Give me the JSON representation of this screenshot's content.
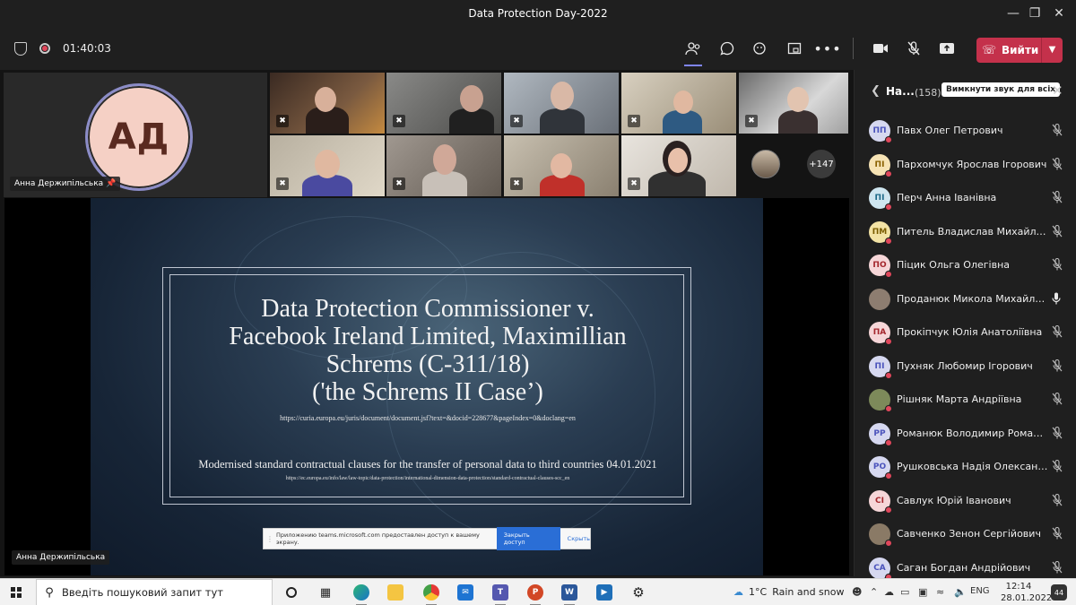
{
  "window": {
    "title": "Data Protection Day-2022",
    "minimize_icon": "minimize-icon",
    "maximize_icon": "restore-icon",
    "close_icon": "close-icon"
  },
  "toolbar": {
    "timer": "01:40:03",
    "leave_label": "Вийти",
    "leave_color": "#c4314b"
  },
  "presenter": {
    "initials": "АД",
    "name": "Анна Держипільська",
    "avatar_color": "#f5d0c5"
  },
  "video_overflow": "+147",
  "slide": {
    "title_line1": "Data Protection Commissioner v.",
    "title_line2": "Facebook Ireland Limited, Maximillian",
    "title_line3": "Schrems (C-311/18)",
    "title_line4": "('the Schrems II Case’)",
    "link1": "https://curia.europa.eu/juris/document/document.jsf?text=&docid=228677&pageIndex=0&doclang=en",
    "subtitle": "Modernised standard contractual clauses for the transfer of personal data to third countries 04.01.2021",
    "link2": "https://ec.europa.eu/info/law/law-topic/data-protection/international-dimension-data-protection/standard-contractual-clauses-scc_en"
  },
  "share_bar": {
    "message": "Приложению teams.microsoft.com предоставлен доступ к вашему экрану.",
    "stop_label": "Закрыть доступ",
    "hide_label": "Скрыть"
  },
  "share_presenter_name": "Анна Держипільська",
  "panel": {
    "title": "На...",
    "count": "(158)",
    "mute_all": "Вимкнути звук для всіх",
    "participants": [
      {
        "initials": "ПП",
        "name": "Павх Олег Петрович",
        "bg": "#d6d8f0",
        "fg": "#4b53bc",
        "mic": "mic-off-icon"
      },
      {
        "initials": "ПІ",
        "name": "Пархомчук Ярослав Ігорович",
        "bg": "#f6e3b4",
        "fg": "#8a6100",
        "mic": "mic-off-icon"
      },
      {
        "initials": "ПІ",
        "name": "Перч Анна Іванівна",
        "bg": "#cfe6f0",
        "fg": "#1e6a89",
        "mic": "mic-off-icon"
      },
      {
        "initials": "ПМ",
        "name": "Питель Владислав Михайлович",
        "bg": "#f3e3a5",
        "fg": "#7a5c00",
        "mic": "mic-off-icon"
      },
      {
        "initials": "ПО",
        "name": "Піцик Ольга Олегівна",
        "bg": "#f6d6d8",
        "fg": "#a4262c",
        "mic": "mic-off-icon"
      },
      {
        "initials": "",
        "name": "Проданюк Микола Михайлович",
        "bg": "#8d7d70",
        "fg": "#fff",
        "mic": "mic-on-icon"
      },
      {
        "initials": "ПА",
        "name": "Прокіпчук Юлія Анатоліївна",
        "bg": "#f6d6d8",
        "fg": "#a4262c",
        "mic": "mic-off-icon"
      },
      {
        "initials": "ПІ",
        "name": "Пухняк Любомир Ігорович",
        "bg": "#d6d8f0",
        "fg": "#4b53bc",
        "mic": "mic-off-icon"
      },
      {
        "initials": "",
        "name": "Рішняк Марта Андріївна",
        "bg": "#7d8a5a",
        "fg": "#fff",
        "mic": "mic-off-icon"
      },
      {
        "initials": "РР",
        "name": "Романюк Володимир Романов...",
        "bg": "#d6d8f0",
        "fg": "#4b53bc",
        "mic": "mic-off-icon"
      },
      {
        "initials": "РО",
        "name": "Рушковська Надія Олександрів...",
        "bg": "#d6d8f0",
        "fg": "#4b53bc",
        "mic": "mic-off-icon"
      },
      {
        "initials": "СІ",
        "name": "Савлук Юрій Іванович",
        "bg": "#f6d6d8",
        "fg": "#a4262c",
        "mic": "mic-off-icon"
      },
      {
        "initials": "",
        "name": "Савченко Зенон Сергійович",
        "bg": "#8a7a66",
        "fg": "#fff",
        "mic": "mic-off-icon"
      },
      {
        "initials": "СА",
        "name": "Саган Богдан Андрійович",
        "bg": "#d6d8f0",
        "fg": "#4b53bc",
        "mic": "mic-off-icon"
      }
    ]
  },
  "taskbar": {
    "search_placeholder": "Введіть пошуковий запит тут",
    "temperature": "1°C",
    "weather": "Rain and snow",
    "language": "ENG",
    "time": "12:14",
    "date": "28.01.2022",
    "notifications": "44"
  }
}
